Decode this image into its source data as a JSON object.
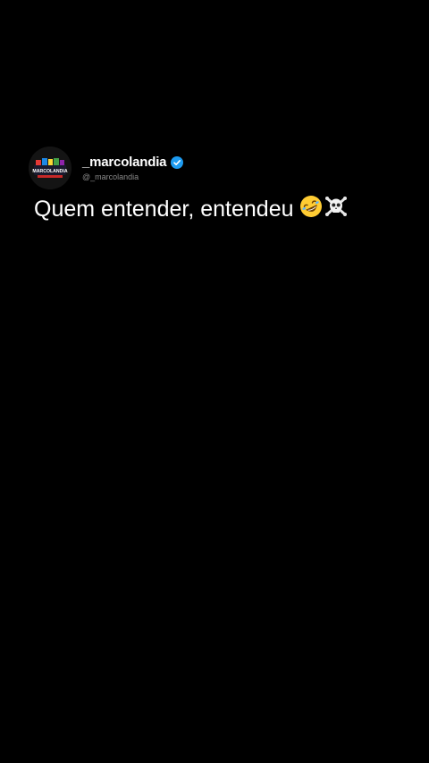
{
  "post": {
    "display_name": "_marcolandia",
    "handle": "@_marcolandia",
    "avatar_text": "MARCOLANDIA",
    "verified_icon": "verified-check-icon",
    "text": "Quem entender, entendeu",
    "emojis": [
      "rolling-on-floor-laughing-emoji",
      "skull-and-crossbones-emoji"
    ]
  },
  "colors": {
    "background": "#000000",
    "text": "#ffffff",
    "handle": "#8a8a8a",
    "verified": "#1d9bf0"
  }
}
